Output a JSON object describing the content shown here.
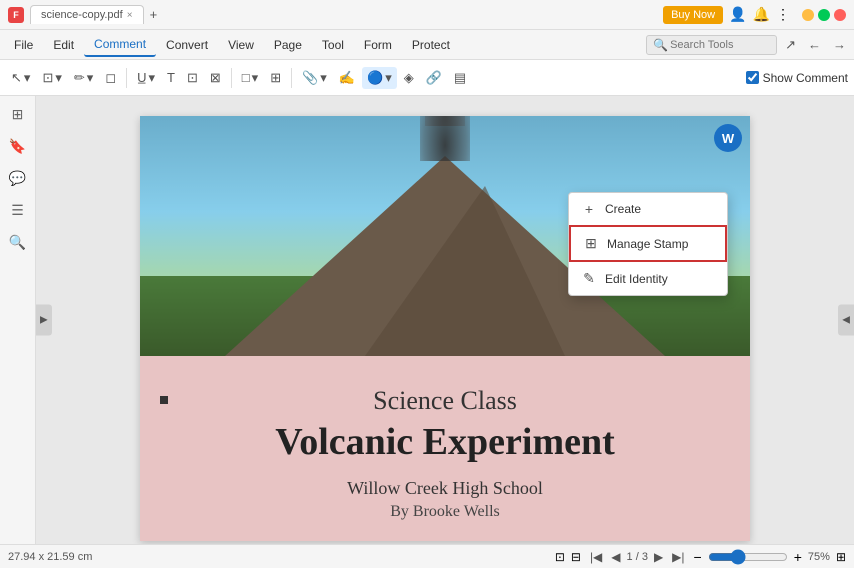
{
  "titleBar": {
    "appName": "science-copy.pdf",
    "tabLabel": "science-copy.pdf",
    "closeTabLabel": "×",
    "addTabLabel": "+",
    "buyNowLabel": "Buy Now",
    "minimizeLabel": "−",
    "maximizeLabel": "□",
    "closeLabel": "×"
  },
  "menuBar": {
    "items": [
      {
        "id": "file",
        "label": "File"
      },
      {
        "id": "edit",
        "label": "Edit"
      },
      {
        "id": "comment",
        "label": "Comment"
      },
      {
        "id": "convert",
        "label": "Convert"
      },
      {
        "id": "view",
        "label": "View"
      },
      {
        "id": "page",
        "label": "Page"
      },
      {
        "id": "tool",
        "label": "Tool"
      },
      {
        "id": "form",
        "label": "Form"
      },
      {
        "id": "protect",
        "label": "Protect"
      }
    ],
    "searchPlaceholder": "Search Tools"
  },
  "toolbar": {
    "showCommentLabel": "Show Comment",
    "showCommentChecked": true
  },
  "dropdown": {
    "items": [
      {
        "id": "create",
        "label": "Create",
        "icon": "+"
      },
      {
        "id": "manage-stamp",
        "label": "Manage Stamp",
        "icon": "⊞",
        "highlighted": true
      },
      {
        "id": "edit-identity",
        "label": "Edit Identity",
        "icon": "✎"
      }
    ]
  },
  "pdfContent": {
    "subtitle": "Science Class",
    "title": "Volcanic Experiment",
    "school": "Willow Creek High School",
    "author": "By Brooke Wells"
  },
  "statusBar": {
    "dimensions": "27.94 x 21.59 cm",
    "currentPage": "1",
    "totalPages": "3",
    "zoomLevel": "75%",
    "pageDisplay": "1 / 3"
  },
  "sidebar": {
    "icons": [
      {
        "id": "thumbnails",
        "symbol": "⊞"
      },
      {
        "id": "bookmarks",
        "symbol": "🔖"
      },
      {
        "id": "comments",
        "symbol": "💬"
      },
      {
        "id": "layers",
        "symbol": "☰"
      },
      {
        "id": "search",
        "symbol": "🔍"
      }
    ]
  }
}
